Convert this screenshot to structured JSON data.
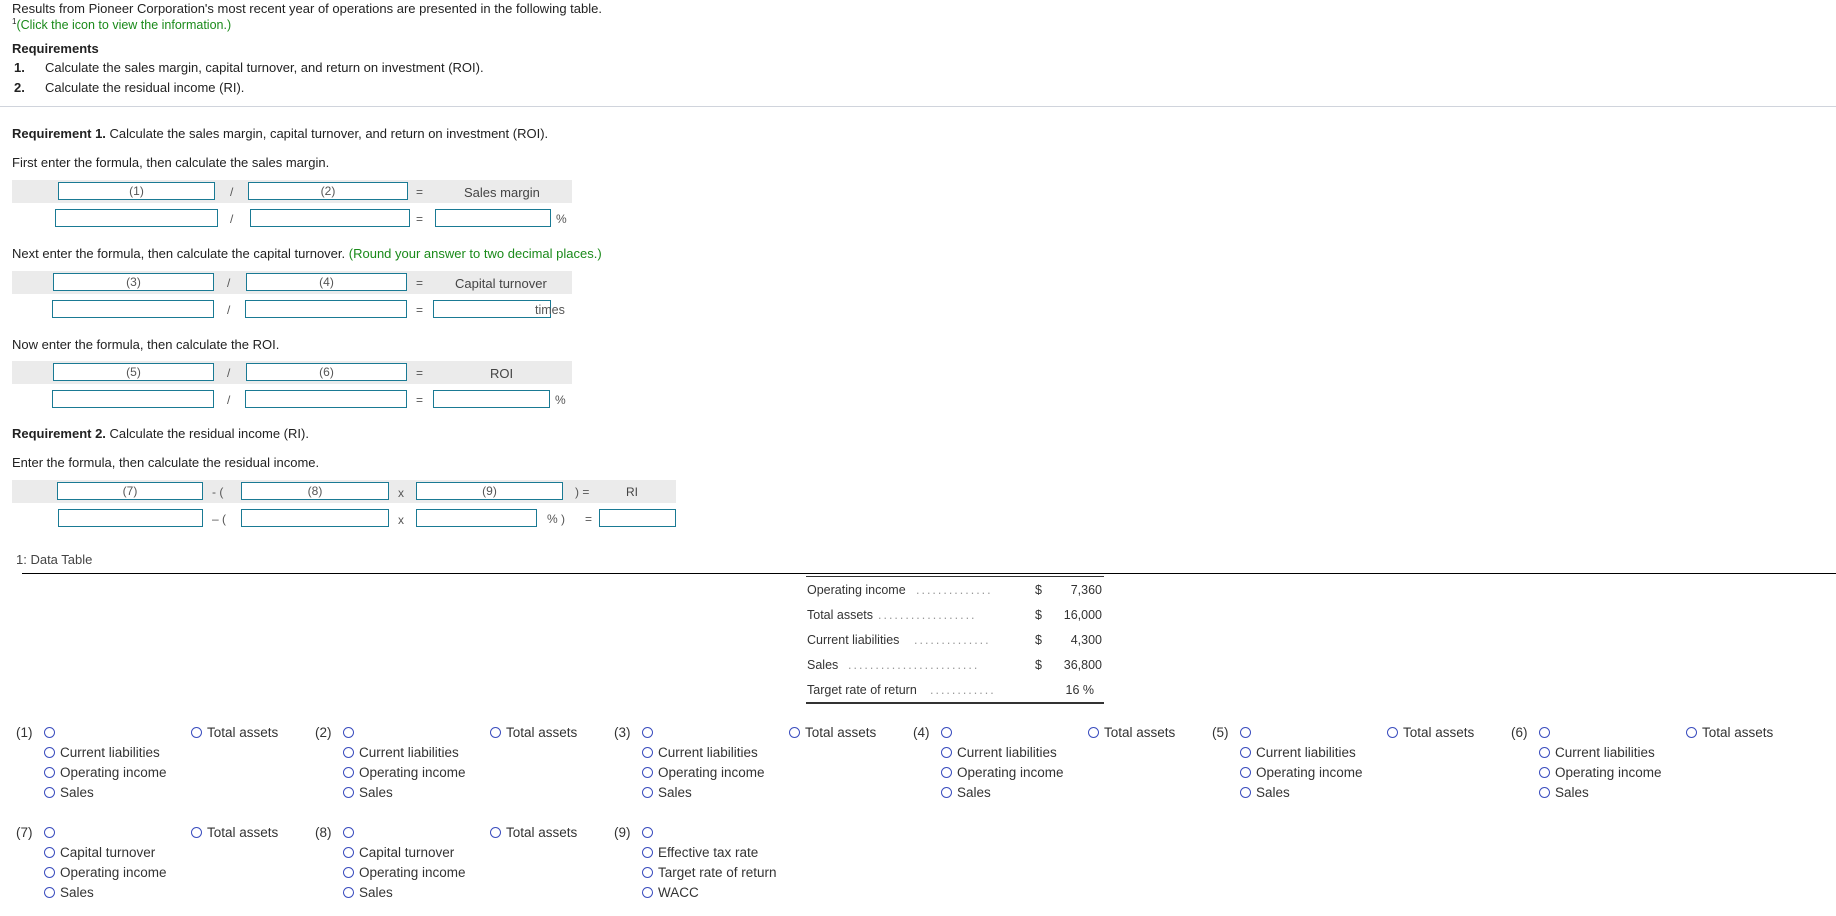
{
  "intro": {
    "text": "Results from Pioneer Corporation's most recent year of operations are presented in the following table.",
    "footnote_mark": "1",
    "click_hint": "(Click the icon to view the information.)"
  },
  "requirements": {
    "heading": "Requirements",
    "items": [
      {
        "num": "1.",
        "text": "Calculate the sales margin, capital turnover, and return on investment (ROI)."
      },
      {
        "num": "2.",
        "text": "Calculate the residual income (RI)."
      }
    ]
  },
  "req1": {
    "title_bold": "Requirement 1.",
    "title_rest": " Calculate the sales margin, capital turnover, and return on investment (ROI).",
    "sales_margin": {
      "instruction": "First enter the formula, then calculate the sales margin.",
      "box1": "(1)",
      "op": "/",
      "box2": "(2)",
      "eq": "=",
      "result_label": "Sales margin",
      "unit": "%",
      "values": {
        "a": "",
        "b": "",
        "result": ""
      }
    },
    "capital_turnover": {
      "instruction": "Next enter the formula, then calculate the capital turnover.",
      "note": "(Round your answer to two decimal places.)",
      "box1": "(3)",
      "op": "/",
      "box2": "(4)",
      "eq": "=",
      "result_label": "Capital turnover",
      "unit": "times",
      "values": {
        "a": "",
        "b": "",
        "result": ""
      }
    },
    "roi": {
      "instruction": "Now enter the formula, then calculate the ROI.",
      "box1": "(5)",
      "op": "/",
      "box2": "(6)",
      "eq": "=",
      "result_label": "ROI",
      "unit": "%",
      "values": {
        "a": "",
        "b": "",
        "result": ""
      }
    }
  },
  "req2": {
    "title_bold": "Requirement 2.",
    "title_rest": " Calculate the residual income (RI).",
    "instruction": "Enter the formula, then calculate the residual income.",
    "box7": "(7)",
    "minus_open": "- (",
    "box8": "(8)",
    "times": "x",
    "box9": "(9)",
    "close_eq": ") =",
    "result_label": "RI",
    "minus_open2": "– (",
    "pct_close": "% )",
    "eq2": "=",
    "values": {
      "a": "",
      "b": "",
      "c": "",
      "result": ""
    }
  },
  "data_table": {
    "title": "1: Data Table",
    "rows": [
      {
        "label": "Operating income",
        "currency": "$",
        "value": "7,360"
      },
      {
        "label": "Total assets",
        "currency": "$",
        "value": "16,000"
      },
      {
        "label": "Current liabilities",
        "currency": "$",
        "value": "4,300"
      },
      {
        "label": "Sales",
        "currency": "$",
        "value": "36,800"
      },
      {
        "label": "Target rate of return",
        "currency": "",
        "value": "16 %"
      }
    ]
  },
  "option_groups": [
    {
      "num": "(1)",
      "options": [
        "",
        "Total assets",
        "Current liabilities",
        "Operating income",
        "Sales"
      ]
    },
    {
      "num": "(2)",
      "options": [
        "",
        "Total assets",
        "Current liabilities",
        "Operating income",
        "Sales"
      ]
    },
    {
      "num": "(3)",
      "options": [
        "",
        "Total assets",
        "Current liabilities",
        "Operating income",
        "Sales"
      ]
    },
    {
      "num": "(4)",
      "options": [
        "",
        "Total assets",
        "Current liabilities",
        "Operating income",
        "Sales"
      ]
    },
    {
      "num": "(5)",
      "options": [
        "",
        "Total assets",
        "Current liabilities",
        "Operating income",
        "Sales"
      ]
    },
    {
      "num": "(6)",
      "options": [
        "",
        "Total assets",
        "Current liabilities",
        "Operating income",
        "Sales"
      ]
    },
    {
      "num": "(7)",
      "options": [
        "",
        "Total assets",
        "Capital turnover",
        "Operating income",
        "Sales"
      ]
    },
    {
      "num": "(8)",
      "options": [
        "",
        "Total assets",
        "Capital turnover",
        "Operating income",
        "Sales"
      ]
    },
    {
      "num": "(9)",
      "options": [
        "",
        "Effective tax rate",
        "Target rate of return",
        "WACC"
      ]
    }
  ]
}
